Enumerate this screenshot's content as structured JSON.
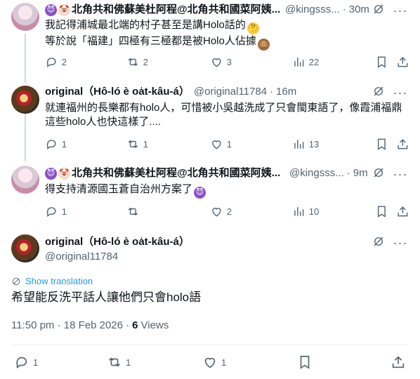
{
  "posts": [
    {
      "display_name": "北角共和佛蘇美杜阿程@北角共和國菜阿姨...",
      "handle": "@kingsss...",
      "time": "30m",
      "lines": [
        "我記得浦城最北端的村子甚至是講Holo話的",
        "等於說「福建」四極有三極都是被Holo人佔據"
      ],
      "replies": "2",
      "reposts": "2",
      "likes": "3",
      "views": "22"
    },
    {
      "display_name": "original（Hô-ló è oa̍t-kâu-á）",
      "handle": "@original11784",
      "time": "16m",
      "lines": [
        "就連福州的長樂都有holo人，可惜被小吳越洗成了只會閩東語了，像霞浦福鼎",
        "這些holo人也快這樣了...."
      ],
      "replies": "1",
      "reposts": "1",
      "likes": "1",
      "views": "13"
    },
    {
      "display_name": "北角共和佛蘇美杜阿程@北角共和國菜阿姨...",
      "handle": "@kingsss...",
      "time": "9m",
      "lines": [
        "得支持清源國玉蒼自治州方案了"
      ],
      "replies": "1",
      "reposts": "",
      "likes": "2",
      "views": "10"
    }
  ],
  "main_post": {
    "display_name": "original（Hô-ló è oa̍t-kâu-á）",
    "handle": "@original11784",
    "translate_label": "Show translation",
    "text": "希望能反洗平話人讓他們只會holo語",
    "timestamp": "11:50 pm · 18 Feb 2026 · ",
    "views_count": "6",
    "views_label": "Views",
    "replies": "1",
    "reposts": "1",
    "likes": "1"
  },
  "separator": "·",
  "more_glyph": "···",
  "emoji": {
    "devil": "😈",
    "clown": "🤡",
    "think": "🤔",
    "monkey": "🙈"
  },
  "colors": {
    "accent": "#1d9bf0",
    "muted": "#536471",
    "text": "#0f1419",
    "divider": "#eff3f4"
  }
}
